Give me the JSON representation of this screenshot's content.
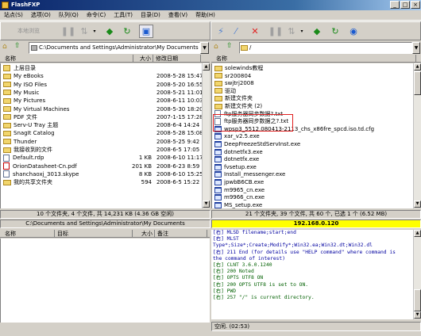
{
  "window": {
    "title": "FlashFXP",
    "min": "_",
    "max": "□",
    "close": "×"
  },
  "menu": [
    "站点(S)",
    "选项(O)",
    "队列(Q)",
    "命令(C)",
    "工具(T)",
    "目录(D)",
    "查看(V)",
    "帮助(H)"
  ],
  "left_toolbar": {
    "label": "本地浏览"
  },
  "left": {
    "path": "C:\\Documents and Settings\\Administrator\\My Documents",
    "columns": {
      "name": "名称",
      "size": "大小",
      "date": "修改日期"
    },
    "rows": [
      {
        "icon": "up",
        "name": "上层目录",
        "size": "",
        "date": ""
      },
      {
        "icon": "folder",
        "name": "My eBooks",
        "size": "",
        "date": "2008-5-28 15:47"
      },
      {
        "icon": "folder",
        "name": "My ISO Files",
        "size": "",
        "date": "2008-5-20 16:55"
      },
      {
        "icon": "folder",
        "name": "My Music",
        "size": "",
        "date": "2008-5-21 11:01"
      },
      {
        "icon": "folder",
        "name": "My Pictures",
        "size": "",
        "date": "2008-6-11 10:03"
      },
      {
        "icon": "folder",
        "name": "My Virtual Machines",
        "size": "",
        "date": "2008-5-30 18:20"
      },
      {
        "icon": "folder",
        "name": "PDF 文件",
        "size": "",
        "date": "2007-1-15 17:28"
      },
      {
        "icon": "folder",
        "name": "Serv-U Tray 主题",
        "size": "",
        "date": "2008-6-4 14:24"
      },
      {
        "icon": "folder",
        "name": "SnagIt Catalog",
        "size": "",
        "date": "2008-5-28 15:08"
      },
      {
        "icon": "folder",
        "name": "Thunder",
        "size": "",
        "date": "2008-5-25 9:42"
      },
      {
        "icon": "folder",
        "name": "我接收到的文件",
        "size": "",
        "date": "2008-6-5 17:05"
      },
      {
        "icon": "file",
        "name": "Default.rdp",
        "size": "1 KB",
        "date": "2008-6-10 11:17"
      },
      {
        "icon": "pdf",
        "name": "OrionDatasheet-Cn.pdf",
        "size": "201 KB",
        "date": "2008-6-23 8:59"
      },
      {
        "icon": "file",
        "name": "shanchaoxj_3013.skype",
        "size": "8 KB",
        "date": "2008-6-10 15:25"
      },
      {
        "icon": "folder",
        "name": "我的共享文件夹",
        "size": "594",
        "date": "2008-6-5 15:22"
      }
    ],
    "status": "10 个文件夹, 4 个文件, 共 14,231 KB (4.36 GB 空闲)",
    "path_status": "C:\\Documents and Settings\\Administrator\\My Documents"
  },
  "right": {
    "path": "/",
    "columns": {
      "name": "名称"
    },
    "rows": [
      {
        "icon": "folder",
        "name": "solewinds教程"
      },
      {
        "icon": "folder",
        "name": "sr200804"
      },
      {
        "icon": "folder",
        "name": "swjtrj2008"
      },
      {
        "icon": "folder",
        "name": "驱动"
      },
      {
        "icon": "folder",
        "name": "新建文件夹"
      },
      {
        "icon": "folder",
        "name": "新建文件夹 (2)"
      },
      {
        "icon": "file",
        "name": "ftp服务器同步数据?.txt"
      },
      {
        "icon": "file",
        "name": "ftp服务器同步数据之?.txt"
      },
      {
        "icon": "exe",
        "name": "wpsp3_5512.080413-2113_chs_x86fre_spcd.iso.td.cfg"
      },
      {
        "icon": "exe",
        "name": "xar_v2.5.exe"
      },
      {
        "icon": "exe",
        "name": "DeepFreezeStdServInst.exe"
      },
      {
        "icon": "exe",
        "name": "dotnetfx3.exe"
      },
      {
        "icon": "exe",
        "name": "dotnetfx.exe"
      },
      {
        "icon": "exe",
        "name": "fvsetup.exe"
      },
      {
        "icon": "exe",
        "name": "Install_messenger.exe"
      },
      {
        "icon": "exe",
        "name": "jpwbB6CB.exe"
      },
      {
        "icon": "exe",
        "name": "m9965_cn.exe"
      },
      {
        "icon": "exe",
        "name": "m9966_cn.exe"
      },
      {
        "icon": "exe",
        "name": "MS_setup.exe"
      }
    ],
    "status": "21 个文件夹, 39 个文件, 共 60 个, 已选 1 个 (6.52 MB)",
    "ip": "192.168.0.120"
  },
  "queue": {
    "columns": {
      "name": "名称",
      "target": "目标",
      "size": "大小",
      "note": "备注"
    }
  },
  "log": [
    {
      "t": "[右]   MLSD filename;start;end",
      "c": "b"
    },
    {
      "t": "[右]   MLST",
      "c": "b"
    },
    {
      "t": "Type*;Size*;Create;Modify*;Win32.ea;Win32.dt;Win32.dl",
      "c": "b"
    },
    {
      "t": "[右] 211 End (for details use \"HELP command\" where command is",
      "c": "b"
    },
    {
      "t": "the command of interest)",
      "c": "b"
    },
    {
      "t": "[右] CLNT 3.6.0.1240",
      "c": "g"
    },
    {
      "t": "[右] 200 Noted",
      "c": "g"
    },
    {
      "t": "[右] OPTS UTF8 ON",
      "c": "g"
    },
    {
      "t": "[右] 200 OPTS UTF8 is set to ON.",
      "c": "g"
    },
    {
      "t": "[右] PWD",
      "c": "g"
    },
    {
      "t": "[右] 257 \"/\" is current directory.",
      "c": "g"
    }
  ],
  "bottom_status": "空闲. (02:53)",
  "colors": {
    "title_start": "#0a246a",
    "highlight_box": "#e02020",
    "ip_bar": "#ffff00",
    "log_text": "#006000"
  }
}
